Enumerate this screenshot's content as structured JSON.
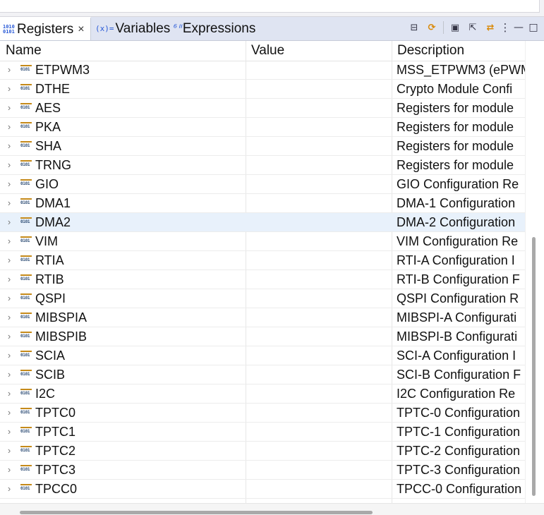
{
  "tabs": [
    {
      "label": "Registers",
      "icon": "registers-icon",
      "icon_glyph": "1010\n0101",
      "active": true,
      "closable": true
    },
    {
      "label": "Variables",
      "icon": "variables-icon",
      "icon_glyph": "(x)=",
      "active": false
    },
    {
      "label": "Expressions",
      "icon": "expressions-icon",
      "icon_glyph": "⁶ᐦ",
      "active": false
    }
  ],
  "close_glyph": "×",
  "toolbar": [
    {
      "name": "collapse-all-icon",
      "glyph": "⊟"
    },
    {
      "name": "refresh-icon",
      "glyph": "⟳"
    },
    {
      "name": "new-group-icon",
      "glyph": "▣"
    },
    {
      "name": "export-icon",
      "glyph": "⇱"
    },
    {
      "name": "sync-icon",
      "glyph": "⇄"
    },
    {
      "name": "view-menu-icon",
      "glyph": "⋮"
    },
    {
      "name": "minimize-icon",
      "glyph": "—"
    },
    {
      "name": "maximize-icon",
      "glyph": "□"
    }
  ],
  "columns": {
    "name": "Name",
    "value": "Value",
    "description": "Description"
  },
  "expand_glyph": "›",
  "row_icon_text": "0101",
  "selected_row": "DMA2",
  "rows": [
    {
      "name": "ETPWM3",
      "value": "",
      "description": "MSS_ETPWM3 (ePWM"
    },
    {
      "name": "DTHE",
      "value": "",
      "description": "Crypto Module Confi"
    },
    {
      "name": "AES",
      "value": "",
      "description": "Registers for module"
    },
    {
      "name": "PKA",
      "value": "",
      "description": "Registers for module"
    },
    {
      "name": "SHA",
      "value": "",
      "description": "Registers for module"
    },
    {
      "name": "TRNG",
      "value": "",
      "description": "Registers for module"
    },
    {
      "name": "GIO",
      "value": "",
      "description": "GIO Configuration Re"
    },
    {
      "name": "DMA1",
      "value": "",
      "description": "DMA-1 Configuration"
    },
    {
      "name": "DMA2",
      "value": "",
      "description": "DMA-2 Configuration"
    },
    {
      "name": "VIM",
      "value": "",
      "description": "VIM Configuration Re"
    },
    {
      "name": "RTIA",
      "value": "",
      "description": "RTI-A Configuration I"
    },
    {
      "name": "RTIB",
      "value": "",
      "description": "RTI-B Configuration F"
    },
    {
      "name": "QSPI",
      "value": "",
      "description": "QSPI Configuration R"
    },
    {
      "name": "MIBSPIA",
      "value": "",
      "description": "MIBSPI-A Configurati"
    },
    {
      "name": "MIBSPIB",
      "value": "",
      "description": "MIBSPI-B Configurati"
    },
    {
      "name": "SCIA",
      "value": "",
      "description": "SCI-A Configuration I"
    },
    {
      "name": "SCIB",
      "value": "",
      "description": "SCI-B Configuration F"
    },
    {
      "name": "I2C",
      "value": "",
      "description": "I2C Configuration Re"
    },
    {
      "name": "TPTC0",
      "value": "",
      "description": "TPTC-0 Configuration"
    },
    {
      "name": "TPTC1",
      "value": "",
      "description": "TPTC-1 Configuration"
    },
    {
      "name": "TPTC2",
      "value": "",
      "description": "TPTC-2 Configuration"
    },
    {
      "name": "TPTC3",
      "value": "",
      "description": "TPTC-3 Configuration"
    },
    {
      "name": "TPCC0",
      "value": "",
      "description": "TPCC-0 Configuration"
    }
  ],
  "colors": {
    "tabbar_bg": "#dfe4f2",
    "selected_row_bg": "#e8f1fb",
    "icon_orange": "#d98a0b"
  }
}
